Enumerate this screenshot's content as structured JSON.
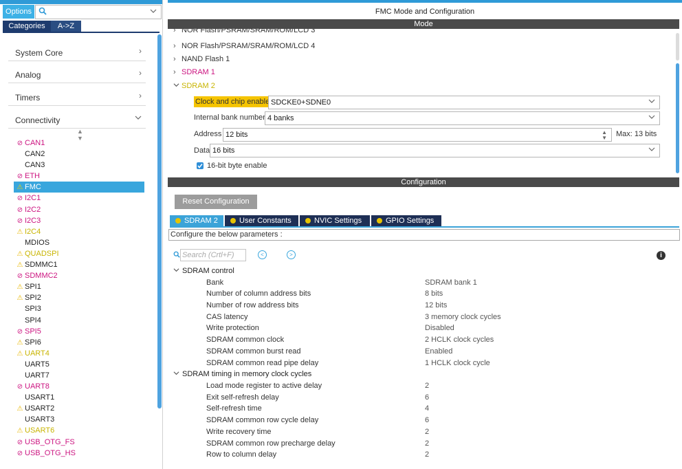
{
  "left": {
    "options_label": "Options",
    "search_placeholder": "",
    "tabs": [
      "Categories",
      "A->Z"
    ],
    "categories": [
      {
        "label": "System Core",
        "arrow": ">"
      },
      {
        "label": "Analog",
        "arrow": ">"
      },
      {
        "label": "Timers",
        "arrow": ">"
      },
      {
        "label": "Connectivity",
        "arrow": "v"
      }
    ],
    "ips": [
      {
        "name": "CAN1",
        "status": "no",
        "color": "pink"
      },
      {
        "name": "CAN2",
        "status": "",
        "color": "blk"
      },
      {
        "name": "CAN3",
        "status": "",
        "color": "blk"
      },
      {
        "name": "ETH",
        "status": "no",
        "color": "pink"
      },
      {
        "name": "FMC",
        "status": "warn",
        "color": "sel"
      },
      {
        "name": "I2C1",
        "status": "no",
        "color": "pink"
      },
      {
        "name": "I2C2",
        "status": "no",
        "color": "pink"
      },
      {
        "name": "I2C3",
        "status": "no",
        "color": "pink"
      },
      {
        "name": "I2C4",
        "status": "warn",
        "color": "yel"
      },
      {
        "name": "MDIOS",
        "status": "",
        "color": "blk"
      },
      {
        "name": "QUADSPI",
        "status": "warn",
        "color": "yel"
      },
      {
        "name": "SDMMC1",
        "status": "warn",
        "color": "blk"
      },
      {
        "name": "SDMMC2",
        "status": "no",
        "color": "pink"
      },
      {
        "name": "SPI1",
        "status": "warn",
        "color": "blk"
      },
      {
        "name": "SPI2",
        "status": "warn",
        "color": "blk"
      },
      {
        "name": "SPI3",
        "status": "",
        "color": "blk"
      },
      {
        "name": "SPI4",
        "status": "",
        "color": "blk"
      },
      {
        "name": "SPI5",
        "status": "no",
        "color": "pink"
      },
      {
        "name": "SPI6",
        "status": "warn",
        "color": "blk"
      },
      {
        "name": "UART4",
        "status": "warn",
        "color": "yel"
      },
      {
        "name": "UART5",
        "status": "",
        "color": "blk"
      },
      {
        "name": "UART7",
        "status": "",
        "color": "blk"
      },
      {
        "name": "UART8",
        "status": "no",
        "color": "pink"
      },
      {
        "name": "USART1",
        "status": "",
        "color": "blk"
      },
      {
        "name": "USART2",
        "status": "warn",
        "color": "blk"
      },
      {
        "name": "USART3",
        "status": "",
        "color": "blk"
      },
      {
        "name": "USART6",
        "status": "warn",
        "color": "yel"
      },
      {
        "name": "USB_OTG_FS",
        "status": "no",
        "color": "pink"
      },
      {
        "name": "USB_OTG_HS",
        "status": "no",
        "color": "pink"
      }
    ]
  },
  "header": {
    "title": "FMC Mode and Configuration",
    "mode_bar": "Mode",
    "config_bar": "Configuration"
  },
  "mode": {
    "tree": [
      {
        "label": "NOR Flash/PSRAM/SRAM/ROM/LCD 3",
        "state": "collapsed",
        "color": "#333333"
      },
      {
        "label": "NOR Flash/PSRAM/SRAM/ROM/LCD 4",
        "state": "collapsed",
        "color": "#333333"
      },
      {
        "label": "NAND Flash 1",
        "state": "collapsed",
        "color": "#333333"
      },
      {
        "label": "SDRAM 1",
        "state": "collapsed",
        "color": "#cc1480"
      },
      {
        "label": "SDRAM 2",
        "state": "expanded",
        "color": "#c8b400"
      }
    ],
    "clock_label": "Clock and chip enable",
    "clock_value": "SDCKE0+SDNE0",
    "bank_label": "Internal bank number",
    "bank_value": "4 banks",
    "address_label": "Address",
    "address_value": "12 bits",
    "address_max": "Max: 13 bits",
    "data_label": "Data",
    "data_value": "16 bits",
    "byte_enable_label": "16-bit byte enable",
    "byte_enable_checked": true
  },
  "config": {
    "reset_label": "Reset Configuration",
    "tabs": [
      "SDRAM 2",
      "User Constants",
      "NVIC Settings",
      "GPIO Settings"
    ],
    "description": "Configure the below parameters :",
    "search_placeholder": "Search (Crtl+F)",
    "groups": [
      {
        "title": "SDRAM control",
        "params": [
          {
            "name": "Bank",
            "value": "SDRAM bank 1"
          },
          {
            "name": "Number of column address bits",
            "value": "8 bits"
          },
          {
            "name": "Number of row address bits",
            "value": "12 bits"
          },
          {
            "name": "CAS latency",
            "value": "3 memory clock cycles"
          },
          {
            "name": "Write protection",
            "value": "Disabled"
          },
          {
            "name": "SDRAM common clock",
            "value": "2 HCLK clock cycles"
          },
          {
            "name": "SDRAM common burst read",
            "value": "Enabled"
          },
          {
            "name": "SDRAM common read pipe delay",
            "value": "1 HCLK clock cycle"
          }
        ]
      },
      {
        "title": "SDRAM timing in memory clock cycles",
        "params": [
          {
            "name": "Load mode register to active delay",
            "value": "2"
          },
          {
            "name": "Exit self-refresh delay",
            "value": "6"
          },
          {
            "name": "Self-refresh time",
            "value": "4"
          },
          {
            "name": "SDRAM common row cycle delay",
            "value": "6"
          },
          {
            "name": "Write recovery time",
            "value": "2"
          },
          {
            "name": "SDRAM common row precharge delay",
            "value": "2"
          },
          {
            "name": "Row to column delay",
            "value": "2"
          }
        ]
      }
    ]
  }
}
